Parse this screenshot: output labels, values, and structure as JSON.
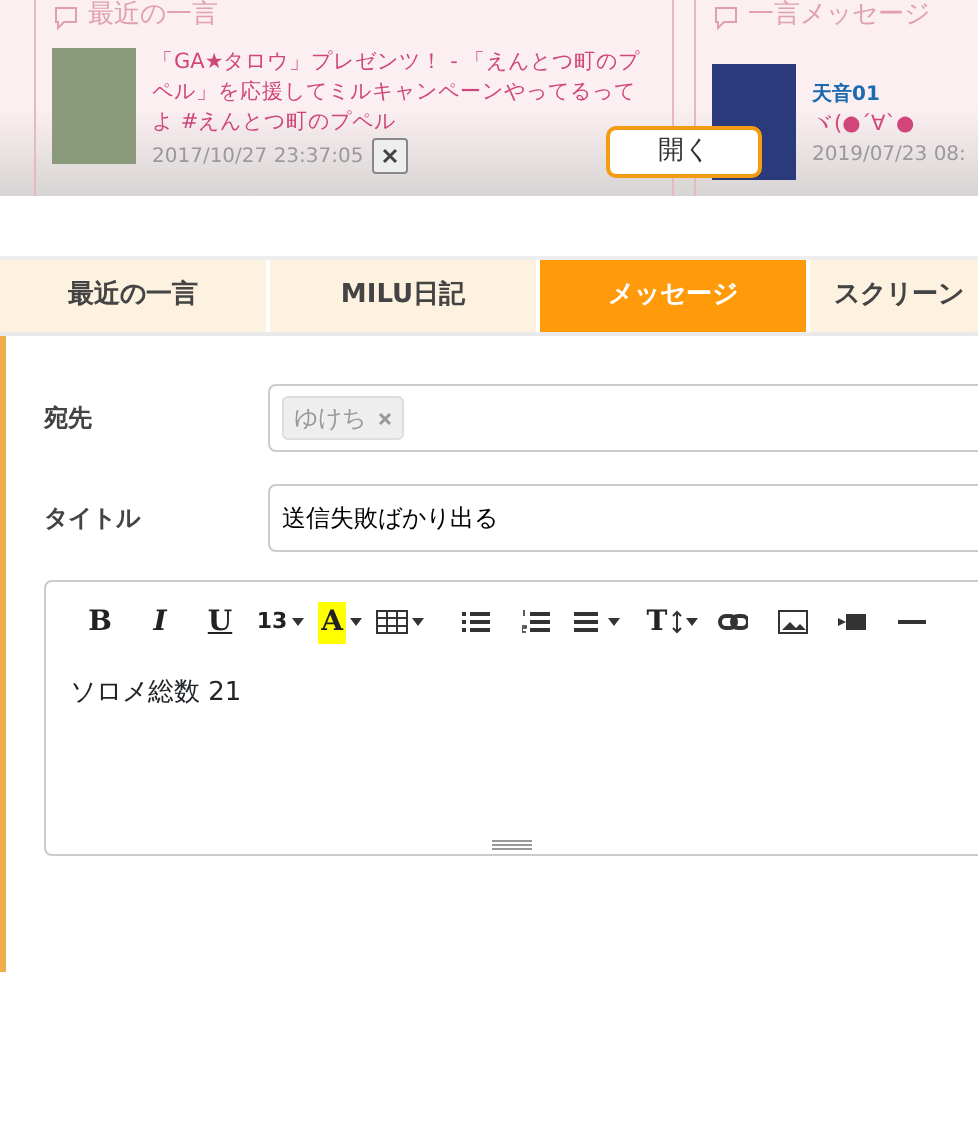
{
  "top_panel": {
    "recent": {
      "title": "最近の一言",
      "items": [
        {
          "text": "「GA★タロウ」プレゼンツ！ - 「えんとつ町のプペル」を応援してミルキャンペーンやってるってよ #えんとつ町のプペル",
          "time": "2017/10/27 23:37:05"
        }
      ]
    },
    "messages": {
      "title": "一言メッセージ",
      "items": [
        {
          "author": "天音01",
          "text": "ヾ(●´∀`●",
          "time": "2019/07/23 08:"
        }
      ]
    },
    "open_button": "開く"
  },
  "tabs": [
    {
      "label": "最近の一言",
      "selected": false
    },
    {
      "label": "MILU日記",
      "selected": false
    },
    {
      "label": "メッセージ",
      "selected": true
    },
    {
      "label": "スクリーン",
      "selected": false
    }
  ],
  "form": {
    "recipient_label": "宛先",
    "recipients": [
      "ゆけち"
    ],
    "title_label": "タイトル",
    "title_value": "送信失敗ばかり出る",
    "editor": {
      "toolbar": [
        {
          "kind": "bold",
          "label": "B"
        },
        {
          "kind": "italic",
          "label": "I"
        },
        {
          "kind": "underline",
          "label": "U"
        },
        {
          "kind": "fontsize",
          "label": "13"
        },
        {
          "kind": "highlight",
          "label": "A"
        },
        {
          "kind": "table"
        },
        {
          "kind": "ul"
        },
        {
          "kind": "ol"
        },
        {
          "kind": "align"
        },
        {
          "kind": "lineheight",
          "label": "T"
        },
        {
          "kind": "link"
        },
        {
          "kind": "image"
        },
        {
          "kind": "video"
        },
        {
          "kind": "hr"
        }
      ],
      "body": "ソロメ総数  21"
    }
  }
}
